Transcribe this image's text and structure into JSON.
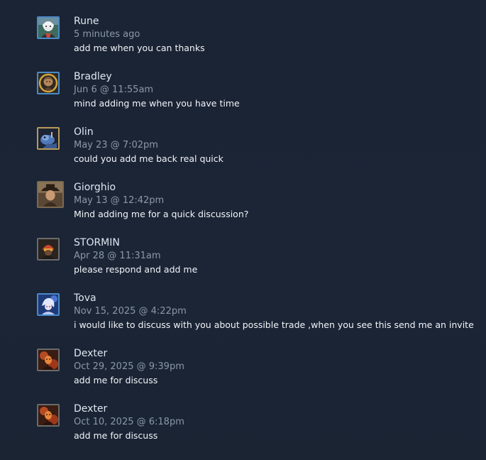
{
  "comments": [
    {
      "author": "Rune",
      "timestamp": "5 minutes ago",
      "text": "add me when you can thanks",
      "avatar_icon": "white-haired-character-avatar"
    },
    {
      "author": "Bradley",
      "timestamp": "Jun 6 @ 11:55am",
      "text": "mind adding me when you have time",
      "avatar_icon": "laurel-wreath-portrait-avatar"
    },
    {
      "author": "Olin",
      "timestamp": "May 23 @ 7:02pm",
      "text": "could you add me back real quick",
      "avatar_icon": "blue-creature-avatar"
    },
    {
      "author": "Giorghio",
      "timestamp": "May 13 @ 12:42pm",
      "text": "Mind adding me for a quick discussion?",
      "avatar_icon": "hat-wearing-character-avatar"
    },
    {
      "author": "STORMIN",
      "timestamp": "Apr 28 @ 11:31am",
      "text": "please respond and add me",
      "avatar_icon": "red-helmet-character-avatar"
    },
    {
      "author": "Tova",
      "timestamp": "Nov 15, 2025 @ 4:22pm",
      "text": "i would like to discuss with you about possible trade ,when you see this send me an invite",
      "avatar_icon": "blue-anime-character-avatar"
    },
    {
      "author": "Dexter",
      "timestamp": "Oct 29, 2025 @ 9:39pm",
      "text": "add me for discuss",
      "avatar_icon": "orange-character-avatar"
    },
    {
      "author": "Dexter",
      "timestamp": "Oct 10, 2025 @ 6:18pm",
      "text": "add me for discuss",
      "avatar_icon": "orange-character-avatar"
    }
  ]
}
